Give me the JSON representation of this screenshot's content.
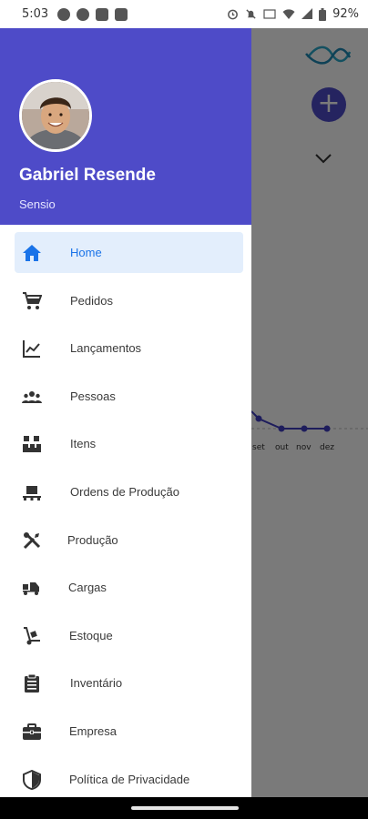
{
  "status_bar": {
    "time": "5:03",
    "battery": "92%"
  },
  "background": {
    "months": [
      "set",
      "out",
      "nov",
      "dez"
    ],
    "chart_data": {
      "type": "line",
      "categories": [
        "set",
        "out",
        "nov",
        "dez"
      ],
      "values": [
        2,
        0,
        0,
        0
      ]
    }
  },
  "drawer": {
    "user_name": "Gabriel Resende",
    "company": "Sensio",
    "items": [
      {
        "label": "Home",
        "icon": "home-icon",
        "active": true
      },
      {
        "label": "Pedidos",
        "icon": "cart-icon"
      },
      {
        "label": "Lançamentos",
        "icon": "trending-icon"
      },
      {
        "label": "Pessoas",
        "icon": "people-icon"
      },
      {
        "label": "Itens",
        "icon": "boxes-icon"
      },
      {
        "label": "Ordens de Produção",
        "icon": "pallet-icon"
      },
      {
        "label": "Produção",
        "icon": "tools-icon"
      },
      {
        "label": "Cargas",
        "icon": "truck-icon"
      },
      {
        "label": "Estoque",
        "icon": "dolly-icon"
      },
      {
        "label": "Inventário",
        "icon": "clipboard-icon"
      },
      {
        "label": "Empresa",
        "icon": "briefcase-icon"
      },
      {
        "label": "Política de Privacidade",
        "icon": "shield-icon"
      }
    ]
  },
  "colors": {
    "header": "#4e4bc8",
    "active_text": "#1a73e8",
    "active_bg": "#e3eefc"
  }
}
